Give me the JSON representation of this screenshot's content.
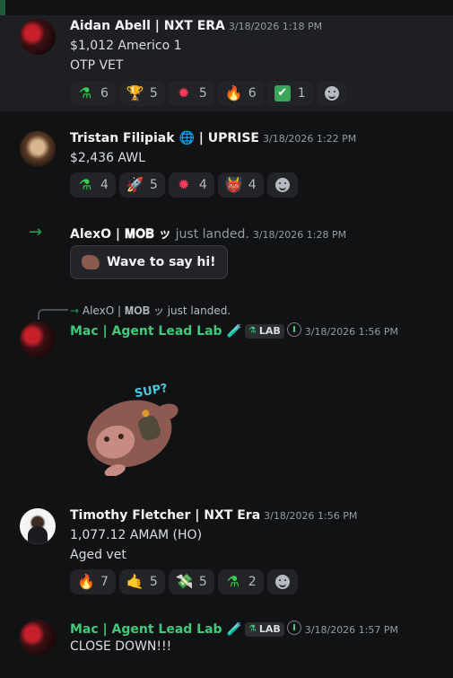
{
  "messages": [
    {
      "author": "Aidan Abell | NXT ERA",
      "time": "3/18/2026 1:18 PM",
      "lines": [
        "$1,012 Americo 1",
        "OTP VET"
      ],
      "reactions": [
        {
          "emoji": "⚗",
          "icon": "flask-icon",
          "count": "6"
        },
        {
          "emoji": "🏆",
          "icon": "trophy-icon",
          "count": "5"
        },
        {
          "emoji": "✹",
          "icon": "fire-gem-icon",
          "count": "5"
        },
        {
          "emoji": "🔥",
          "icon": "fire-hand-icon",
          "count": "6"
        },
        {
          "emoji": "✔",
          "icon": "check-icon",
          "count": "1"
        }
      ]
    },
    {
      "author": "Tristan Filipiak 🌐 | UPRISE",
      "time": "3/18/2026 1:22 PM",
      "lines": [
        "$2,436 AWL"
      ],
      "reactions": [
        {
          "emoji": "⚗",
          "icon": "flask-icon",
          "count": "4"
        },
        {
          "emoji": "🚀",
          "icon": "rocket-icon",
          "count": "5"
        },
        {
          "emoji": "✹",
          "icon": "fire-gem-icon",
          "count": "4"
        },
        {
          "emoji": "👹",
          "icon": "demon-icon",
          "count": "4"
        }
      ]
    },
    {
      "author": "AlexO | 𝐌𝐎𝐁 ッ",
      "action": "just landed.",
      "time": "3/18/2026 1:28 PM",
      "wave_label": "Wave to say hi!"
    },
    {
      "reply_to": "AlexO | 𝐌𝐎𝐁 ッ just landed.",
      "author": "Mac | Agent Lead Lab 🧪",
      "tag": "LAB",
      "time": "3/18/2026 1:56 PM",
      "sticker_text": "SUP?"
    },
    {
      "author": "Timothy Fletcher | NXT Era",
      "time": "3/18/2026 1:56 PM",
      "lines": [
        "1,077.12 AMAM (HO)",
        "Aged vet"
      ],
      "reactions": [
        {
          "emoji": "🔥",
          "icon": "fire-icon",
          "count": "7"
        },
        {
          "emoji": "🤙",
          "icon": "call-me-hand-icon",
          "count": "5"
        },
        {
          "emoji": "💸",
          "icon": "money-wings-icon",
          "count": "5"
        },
        {
          "emoji": "⚗",
          "icon": "flask-icon",
          "count": "2"
        }
      ]
    },
    {
      "author": "Mac | Agent Lead Lab 🧪",
      "tag": "LAB",
      "time": "3/18/2026 1:57 PM",
      "lines": [
        "CLOSE DOWN!!!"
      ]
    }
  ],
  "colors": {
    "background": "#111214",
    "highlight": "#1e1f22",
    "role_green": "#3fc97a",
    "reaction_bg": "#232428"
  }
}
